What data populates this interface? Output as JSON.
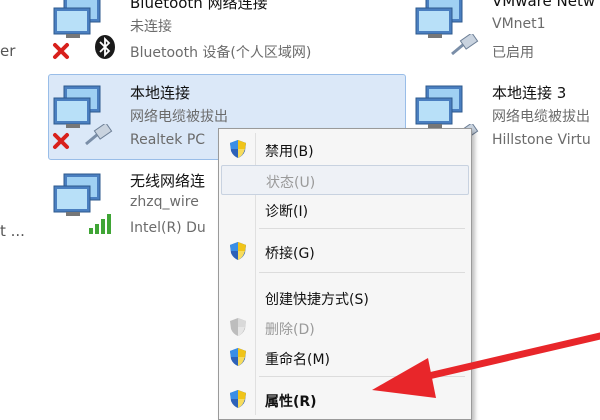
{
  "left_edge_fragments": [
    "er",
    "t ..."
  ],
  "connections": {
    "bluetooth": {
      "name": "Bluetooth 网络连接",
      "status": "未连接",
      "device": "Bluetooth 设备(个人区域网)"
    },
    "vmnet1": {
      "name": "VMware Netw",
      "status": "VMnet1",
      "device": "已启用"
    },
    "local": {
      "name": "本地连接",
      "status": "网络电缆被拔出",
      "device": "Realtek PC"
    },
    "local3": {
      "name": "本地连接 3",
      "status": "网络电缆被拔出",
      "device": "Hillstone Virtu"
    },
    "wireless": {
      "name": "无线网络连",
      "status": "zhzq_wire",
      "device": "Intel(R) Du"
    }
  },
  "context_menu": {
    "items": [
      {
        "label": "禁用(B)",
        "shield": true,
        "disabled": false
      },
      {
        "label": "状态(U)",
        "shield": false,
        "disabled": true
      },
      {
        "label": "诊断(I)",
        "shield": false,
        "disabled": false
      },
      {
        "label": "桥接(G)",
        "shield": true,
        "disabled": false
      },
      {
        "label": "创建快捷方式(S)",
        "shield": false,
        "disabled": false
      },
      {
        "label": "删除(D)",
        "shield": true,
        "disabled": true
      },
      {
        "label": "重命名(M)",
        "shield": true,
        "disabled": false
      },
      {
        "label": "属性(R)",
        "shield": true,
        "disabled": false
      }
    ]
  },
  "colors": {
    "accent_arrow": "#e8262a",
    "selection": "#dbe8f8",
    "x_mark": "#d8201c"
  }
}
